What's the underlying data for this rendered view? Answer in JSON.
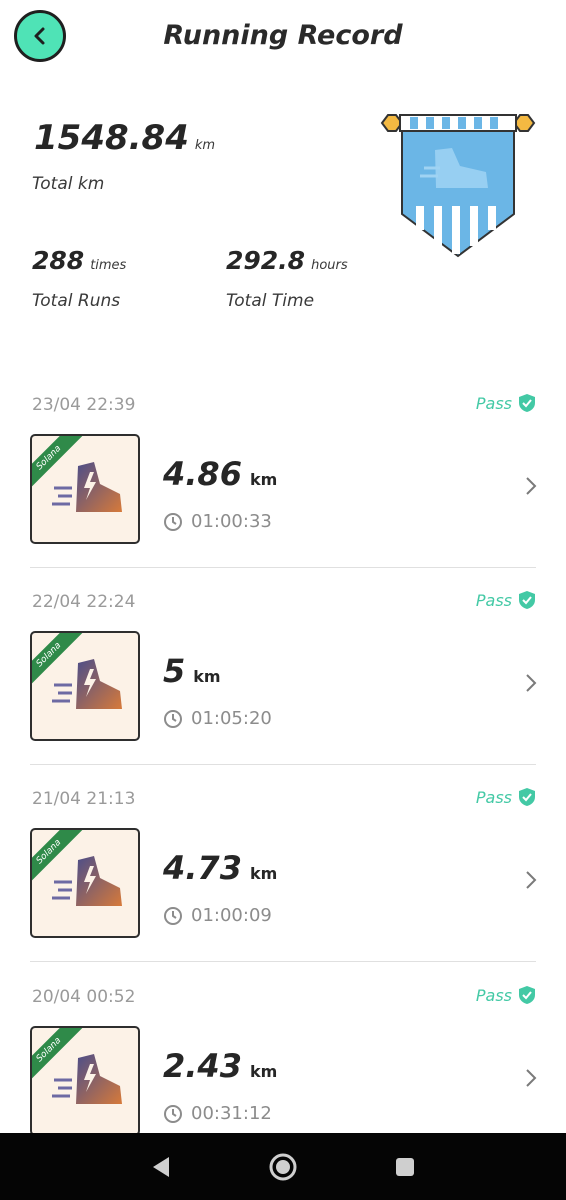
{
  "header": {
    "title": "Running Record"
  },
  "stats": {
    "total_km": "1548.84",
    "total_km_unit": "km",
    "total_km_label": "Total km",
    "runs": "288",
    "runs_unit": "times",
    "runs_label": "Total Runs",
    "time": "292.8",
    "time_unit": "hours",
    "time_label": "Total Time"
  },
  "records": [
    {
      "date": "23/04 22:39",
      "status": "Pass",
      "distance": "4.86",
      "unit": "km",
      "duration": "01:00:33",
      "badge": "Solana"
    },
    {
      "date": "22/04 22:24",
      "status": "Pass",
      "distance": "5",
      "unit": "km",
      "duration": "01:05:20",
      "badge": "Solana"
    },
    {
      "date": "21/04 21:13",
      "status": "Pass",
      "distance": "4.73",
      "unit": "km",
      "duration": "01:00:09",
      "badge": "Solana"
    },
    {
      "date": "20/04 00:52",
      "status": "Pass",
      "distance": "2.43",
      "unit": "km",
      "duration": "00:31:12",
      "badge": "Solana"
    }
  ],
  "colors": {
    "accent": "#4fe3b6",
    "pass": "#43c9a5",
    "pennant": "#6bb6e6"
  },
  "icons": [
    "back-arrow-icon",
    "pennant-shoe-icon",
    "pass-check-icon",
    "shoe-icon",
    "clock-icon",
    "chevron-right-icon",
    "nav-back-icon",
    "nav-home-icon",
    "nav-recents-icon"
  ]
}
